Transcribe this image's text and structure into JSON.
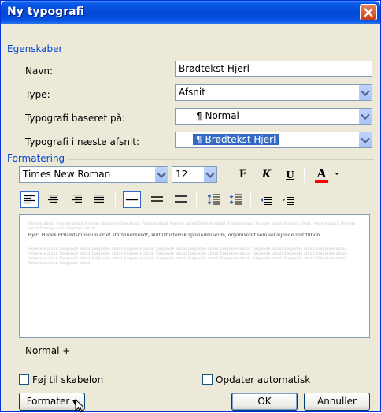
{
  "window": {
    "title": "Ny typografi"
  },
  "egenskaber": {
    "label": "Egenskaber",
    "navn_label": "Navn:",
    "navn_value": "Brødtekst Hjerl",
    "type_label": "Type:",
    "type_value": "Afsnit",
    "baseret_label": "Typografi baseret på:",
    "baseret_value": "Normal",
    "naeste_label": "Typografi i næste afsnit:",
    "naeste_value": "Brødtekst Hjerl",
    "pilcrow": "¶"
  },
  "formatering": {
    "label": "Formatering",
    "font_value": "Times New Roman",
    "size_value": "12",
    "bold": "F",
    "italic": "K",
    "underline": "U",
    "font_color": "A"
  },
  "preview": {
    "grey_before": "Forrige afsnit Forrige afsnit Forrige afsnit Forrige afsnit Forrige afsnit Forrige afsnit Forrige afsnit Forrige afsnit Forrige afsnit Forrige afsnit Forrige afsnit Forrige afsnit Forrige afsnit Forrige afsnit",
    "text": "Hjerl Hedes Frilandsmuseum er et statsanerkendt, kulturhistorisk specialmuseum, organiseret som selvejende institution.",
    "grey_after": "Følgende afsnit Følgende afsnit Følgende afsnit Følgende afsnit Følgende afsnit Følgende afsnit Følgende afsnit Følgende afsnit Følgende afsnit Følgende afsnit Følgende afsnit Følgende afsnit Følgende afsnit Følgende afsnit Følgende afsnit Følgende afsnit Følgende afsnit Følgende afsnit Følgende afsnit Følgende afsnit Følgende afsnit Følgende afsnit Følgende afsnit Følgende afsnit Følgende afsnit Følgende afsnit Følgende afsnit Følgende afsnit Følgende afsnit Følgende afsnit Følgende afsnit Følgende afsnit"
  },
  "description": "Normal +",
  "footer": {
    "add_template": "Føj til skabelon",
    "auto_update": "Opdater automatisk",
    "format_button": "Formater",
    "ok_button": "OK",
    "cancel_button": "Annuller"
  },
  "colors": {
    "accent": "#0046d5",
    "title_bar": "#0454e5",
    "selection": "#316ac5",
    "font_color_bar": "#ff0000"
  }
}
